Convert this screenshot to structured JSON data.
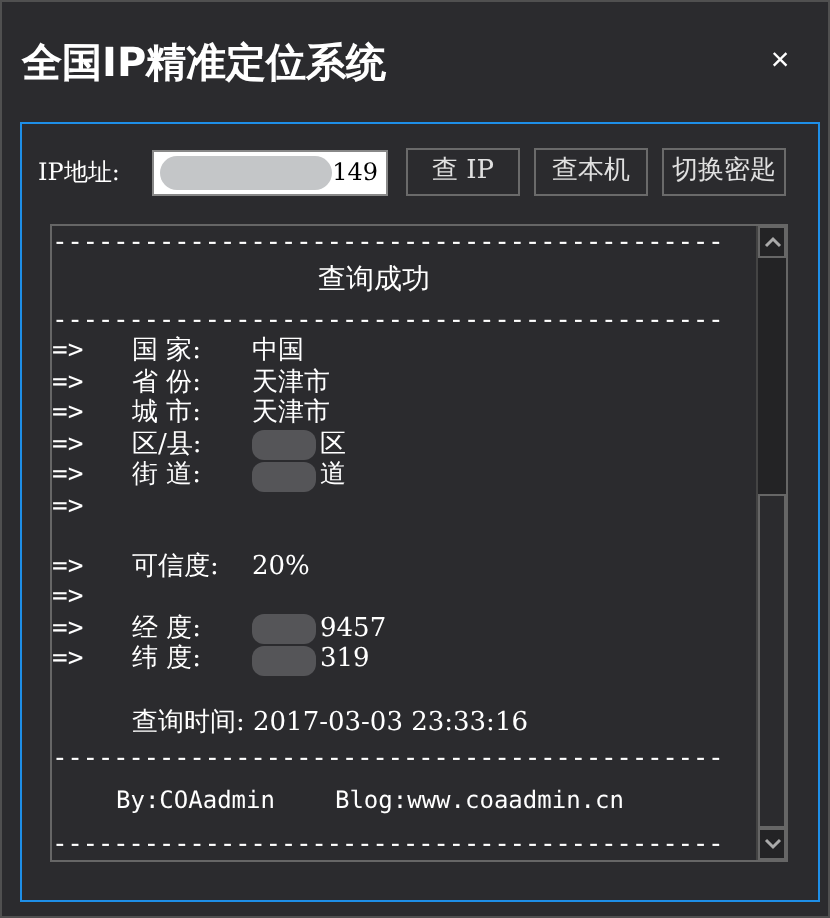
{
  "window": {
    "title": "全国IP精准定位系统",
    "close": "×"
  },
  "query": {
    "label": "IP地址:",
    "value": "149",
    "redacted": true
  },
  "buttons": [
    "查 IP",
    "查本机",
    "切换密匙"
  ],
  "output": [
    {
      "kind": "rule",
      "text": "--------------------------------------------"
    },
    {
      "kind": "title",
      "text": "查询成功"
    },
    {
      "kind": "rule",
      "text": "--------------------------------------------"
    },
    {
      "kind": "field",
      "prefix": "=>",
      "label": "国 家:",
      "value": "中国",
      "redacted": false
    },
    {
      "kind": "field",
      "prefix": "=>",
      "label": "省 份:",
      "value": "天津市",
      "redacted": false
    },
    {
      "kind": "field",
      "prefix": "=>",
      "label": "城 市:",
      "value": "天津市",
      "redacted": false
    },
    {
      "kind": "field",
      "prefix": "=>",
      "label": "区/县:",
      "value": "区",
      "redacted": true
    },
    {
      "kind": "field",
      "prefix": "=>",
      "label": "街 道:",
      "value": "道",
      "redacted": true
    },
    {
      "kind": "arrow",
      "prefix": "=>"
    },
    {
      "kind": "blank"
    },
    {
      "kind": "field",
      "prefix": "=>",
      "label": "可信度:",
      "value": "20%",
      "redacted": false
    },
    {
      "kind": "arrow",
      "prefix": "=>"
    },
    {
      "kind": "field",
      "prefix": "=>",
      "label": "经 度:",
      "value": "9457",
      "redacted": true
    },
    {
      "kind": "field",
      "prefix": "=>",
      "label": "纬 度:",
      "value": "319",
      "redacted": true
    },
    {
      "kind": "blank"
    },
    {
      "kind": "plain",
      "text": "查询时间: 2017-03-03 23:33:16"
    },
    {
      "kind": "rule",
      "text": "--------------------------------------------"
    },
    {
      "kind": "credit",
      "author": "By:COAadmin",
      "blog": "Blog:www.coaadmin.cn"
    },
    {
      "kind": "rule",
      "text": "--------------------------------------------"
    }
  ]
}
